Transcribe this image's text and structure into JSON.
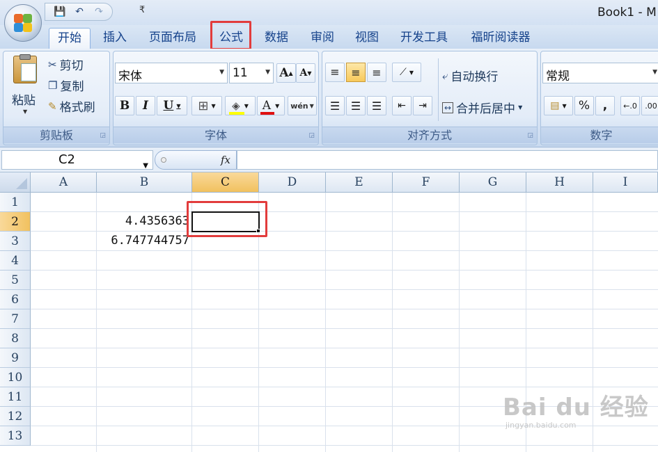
{
  "window": {
    "title": "Book1 - M"
  },
  "quick_access": {
    "items": [
      {
        "icon": "save-icon",
        "glyph": "💾"
      },
      {
        "icon": "undo-icon",
        "glyph": "↶"
      },
      {
        "icon": "redo-icon",
        "glyph": "↷"
      }
    ],
    "customize_glyph": "₹"
  },
  "tabs": [
    {
      "label": "开始",
      "active": true
    },
    {
      "label": "插入"
    },
    {
      "label": "页面布局"
    },
    {
      "label": "公式",
      "highlighted": true
    },
    {
      "label": "数据"
    },
    {
      "label": "审阅"
    },
    {
      "label": "视图"
    },
    {
      "label": "开发工具"
    },
    {
      "label": "福昕阅读器"
    }
  ],
  "ribbon": {
    "clipboard": {
      "label": "剪贴板",
      "paste": "粘贴",
      "cut": "剪切",
      "copy": "复制",
      "format_painter": "格式刷"
    },
    "font": {
      "label": "字体",
      "font_name": "宋体",
      "font_size": "11",
      "bold": "B",
      "italic": "I",
      "underline": "U",
      "grow_glyph": "A",
      "shrink_glyph": "A",
      "phonetic_glyph": "wén",
      "font_color": "#e01010",
      "fill_color": "#ffff00"
    },
    "alignment": {
      "label": "对齐方式",
      "wrap_text": "自动换行",
      "merge_center": "合并后居中"
    },
    "number": {
      "label": "数字",
      "format": "常规",
      "percent": "%",
      "comma": ","
    }
  },
  "formula_bar": {
    "name_box": "C2",
    "fx_label": "fx",
    "formula": ""
  },
  "sheet": {
    "columns": [
      "A",
      "B",
      "C",
      "D",
      "E",
      "F",
      "G",
      "H",
      "I"
    ],
    "rows": [
      "1",
      "2",
      "3",
      "4",
      "5",
      "6",
      "7",
      "8",
      "9",
      "10",
      "11",
      "12",
      "13"
    ],
    "selected_column": "C",
    "selected_row": "2",
    "cells": {
      "B2": "4.4356363",
      "B3": "6.747744757"
    }
  },
  "watermark": {
    "main": "Bai du 经验",
    "sub": "jingyan.baidu.com"
  },
  "colors": {
    "highlight_box": "#e23c3c",
    "selected_header": "#f1c15f"
  }
}
